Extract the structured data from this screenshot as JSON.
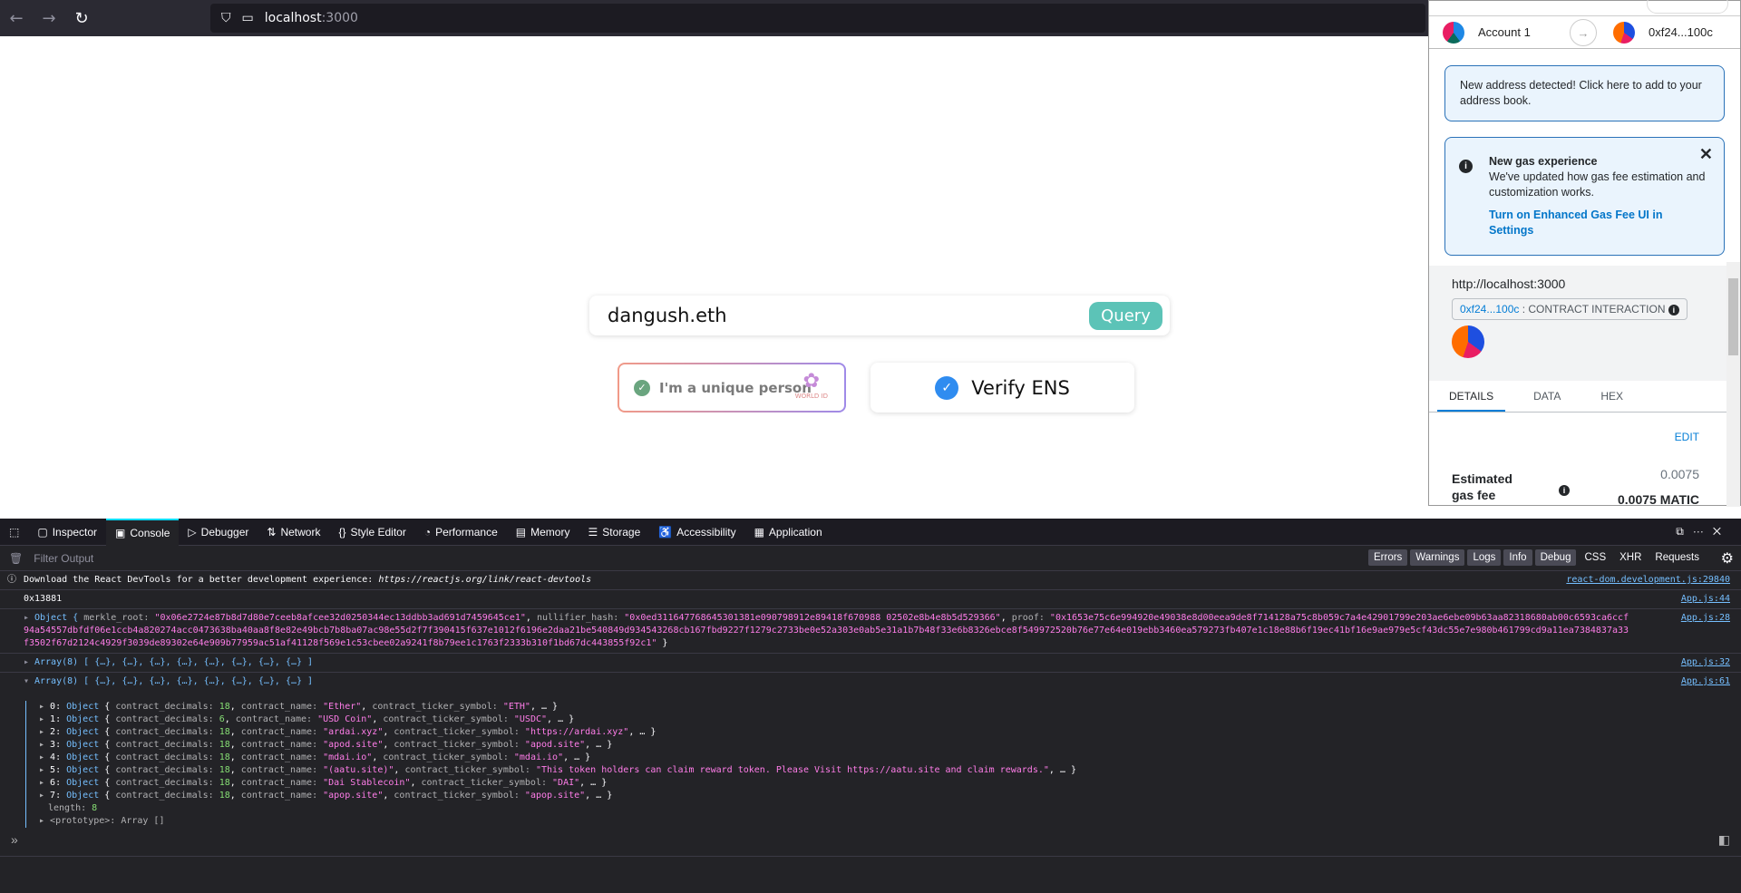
{
  "browser": {
    "url_host": "localhost",
    "url_port": ":3000",
    "icons": [
      "back-icon",
      "forward-icon",
      "reload-icon",
      "shield-icon",
      "page-icon"
    ]
  },
  "page": {
    "search_value": "dangush.eth",
    "query_label": "Query",
    "worldid_label": "I'm a unique person",
    "worldid_logo_text": "WORLD ID",
    "verify_label": "Verify ENS",
    "accent": "#5cc3b7"
  },
  "metamask": {
    "account_name": "Account 1",
    "recipient": "0xf24...100c",
    "notice": "New address detected! Click here to add to your address book.",
    "gas_title": "New gas experience",
    "gas_text": "We've updated how gas fee estimation and customization works.",
    "gas_link": "Turn on Enhanced Gas Fee UI in Settings",
    "origin": "http://localhost:3000",
    "contract_addr": "0xf24...100c",
    "contract_label": " : CONTRACT INTERACTION",
    "tabs": [
      "DETAILS",
      "DATA",
      "HEX"
    ],
    "edit": "EDIT",
    "gas_label": "Estimated gas fee",
    "gas_value": "0.0075",
    "gas_value_bold": "0.0075 MATIC"
  },
  "devtools": {
    "tabs": [
      "Inspector",
      "Console",
      "Debugger",
      "Network",
      "Style Editor",
      "Performance",
      "Memory",
      "Storage",
      "Accessibility",
      "Application"
    ],
    "filter_placeholder": "Filter Output",
    "filters": [
      "Errors",
      "Warnings",
      "Logs",
      "Info",
      "Debug",
      "CSS",
      "XHR",
      "Requests"
    ],
    "messages": [
      {
        "text": "Download the React DevTools for a better development experience: ",
        "link": "https://reactjs.org/link/react-devtools",
        "src": "react-dom.development.js:29840"
      },
      {
        "text": "0x13881",
        "src": "App.js:44"
      },
      {
        "merkle_root": "0x06e2724e87b8d7d80e7ceeb8afcee32d0250344ec13ddbb3ad691d7459645ce1",
        "nullifier_hash": "0x0ed311647768645301381e090798912e89418f670988 02502e8b4e8b5d529366",
        "proof": "0x1653e75c6e994920e49038e8d00eea9de8f714128a75c8b059c7a4e42901799e203ae6ebe09b63aa82318680ab00c6593ca6ccf94a54557dbfdf06e1ccb4a820274acc0473638ba40aa8f8e82e49bcb7b8ba07ac98e55d2f7f390415f637e1012f6196e2daa21be540849d934543268cb167fbd9227f1279c2733be0e52a303e0ab5e31a1b7b48f33e6b8326ebce8f549972520b76e77e64e019ebb3460ea579273fb407e1c18e88b6f19ec41bf16e9ae979e5cf43dc55e7e980b461799cd9a11ea7384837a33f3502f67d2124c4929f3039de89302e64e909b77959ac51af41128f569e1c53cbee02a9241f8b79ee1c1763f2333b310f1bd67dc443855f92c1",
        "src": "App.js:28"
      },
      {
        "text": "Array(8) [ {…}, {…}, {…}, {…}, {…}, {…}, {…}, {…} ]",
        "src": "App.js:32"
      },
      {
        "text": "Array(8) [ {…}, {…}, {…}, {…}, {…}, {…}, {…}, {…} ]",
        "src": "App.js:61",
        "length": "8",
        "prototype": "<prototype>: Array []"
      }
    ],
    "tokens": [
      {
        "decimals": "18",
        "name": "Ether",
        "ticker": "ETH"
      },
      {
        "decimals": "6",
        "name": "USD Coin",
        "ticker": "USDC"
      },
      {
        "decimals": "18",
        "name": "ardai.xyz",
        "ticker": "https://ardai.xyz"
      },
      {
        "decimals": "18",
        "name": "apod.site",
        "ticker": "apod.site"
      },
      {
        "decimals": "18",
        "name": "mdai.io",
        "ticker": "mdai.io"
      },
      {
        "decimals": "18",
        "name": "(aatu.site)",
        "ticker": "This token holders can claim reward token. Please Visit https://aatu.site and claim rewards."
      },
      {
        "decimals": "18",
        "name": "Dai Stablecoin",
        "ticker": "DAI"
      },
      {
        "decimals": "18",
        "name": "apop.site",
        "ticker": "apop.site"
      }
    ]
  }
}
